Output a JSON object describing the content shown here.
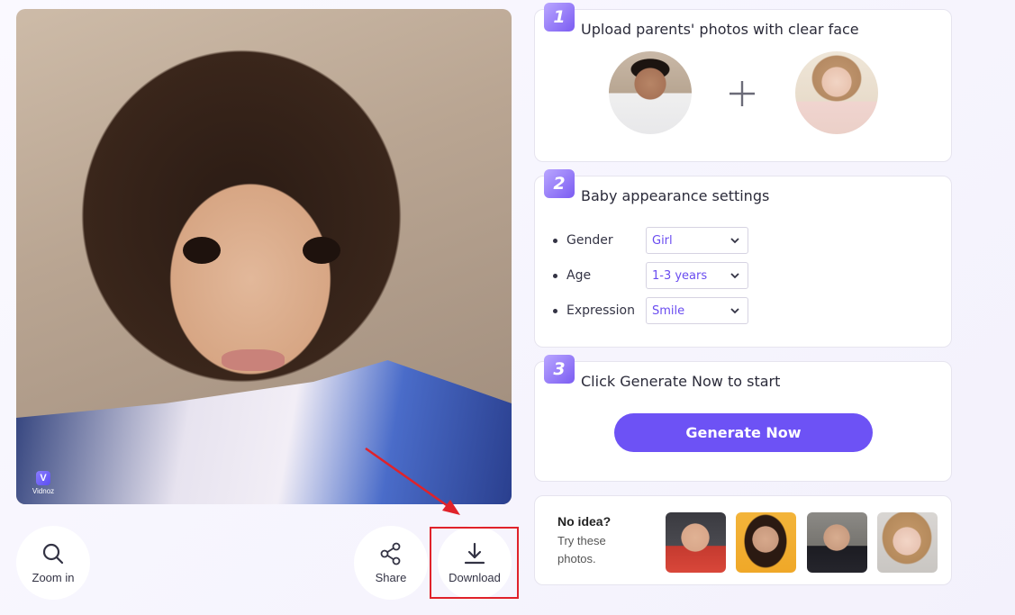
{
  "result": {
    "image_alt": "Generated baby photo",
    "watermark": "Vidnoz"
  },
  "actions": {
    "zoom_label": "Zoom in",
    "share_label": "Share",
    "download_label": "Download"
  },
  "steps": [
    {
      "number": "1",
      "title": "Upload parents' photos with clear face"
    },
    {
      "number": "2",
      "title": "Baby appearance settings"
    },
    {
      "number": "3",
      "title": "Click Generate Now to start"
    }
  ],
  "settings": {
    "gender": {
      "label": "Gender",
      "value": "Girl"
    },
    "age": {
      "label": "Age",
      "value": "1-3 years"
    },
    "expression": {
      "label": "Expression",
      "value": "Smile"
    }
  },
  "generate_label": "Generate Now",
  "samples": {
    "title": "No idea?",
    "subtitle": "Try these photos."
  },
  "icons": {
    "zoom": "search-icon",
    "share": "share-icon",
    "download": "download-icon",
    "plus": "plus-icon",
    "dropdown": "chevron-down-icon"
  },
  "colors": {
    "accent": "#6d52f5",
    "select_text": "#6a4cf0",
    "highlight": "#e0222a"
  }
}
